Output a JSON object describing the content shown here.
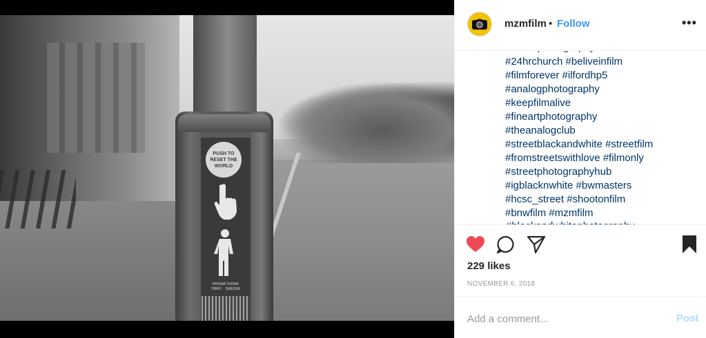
{
  "photo": {
    "sticker_text": [
      "PUSH TO",
      "RESET THE",
      "WORLD"
    ],
    "brand_text": [
      "PRISMA TEKNIK",
      "TIBRO",
      "SWEDEN"
    ]
  },
  "header": {
    "username": "mzmfilm",
    "separator": "•",
    "follow_label": "Follow",
    "more_label": "•••"
  },
  "caption": {
    "hashtag_lines": [
      "#24hrchurch #beliveinfilm",
      "#filmforever #ilfordhp5",
      "#analogphotography",
      "#keepfilmalive",
      "#fineartphotography",
      "#theanalogclub",
      "#streetblackandwhite #streetfilm",
      "#fromstreetswithlove #filmonly",
      "#streetphotographyhub",
      "#igblacknwhite #bwmasters",
      "#hcsc_street #shootonfilm",
      "#bnwfilm #mzmfilm"
    ]
  },
  "actions": {
    "likes_text": "229 likes",
    "date_text": "NOVEMBER 6, 2018",
    "liked": true,
    "heart_color": "#ed4956"
  },
  "comment": {
    "placeholder": "Add a comment...",
    "post_label": "Post",
    "post_color": "#b3dbff"
  },
  "colors": {
    "link_blue": "#3897f0",
    "hashtag_navy": "#003569",
    "text_dark": "#262626",
    "muted": "#999999"
  }
}
